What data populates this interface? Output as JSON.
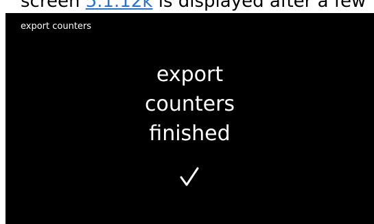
{
  "caption": {
    "prefix": "screen ",
    "link": "5.1.12k",
    "suffix": " is displayed after a few"
  },
  "screen": {
    "title": "export counters",
    "message_lines": [
      "export",
      "counters",
      "finished"
    ],
    "status_icon": "checkmark-icon",
    "colors": {
      "background": "#000000",
      "text": "#ffffff",
      "link": "#2a73c8"
    }
  }
}
